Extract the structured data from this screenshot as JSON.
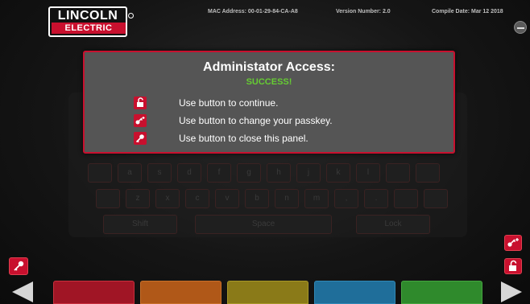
{
  "header": {
    "logo_top": "LINCOLN",
    "logo_bottom": "ELECTRIC",
    "mac_address": "MAC Address: 00-01-29-84-CA-A8",
    "version": "Version Number: 2.0",
    "compile_date": "Compile Date: Mar 12 2018"
  },
  "dialog": {
    "title": "Administator Access:",
    "status": "SUCCESS!",
    "rows": [
      {
        "icon": "unlock-icon",
        "text": "Use button to continue."
      },
      {
        "icon": "key-edit-icon",
        "text": "Use button to change your passkey."
      },
      {
        "icon": "key-icon",
        "text": "Use button to close this panel."
      }
    ]
  },
  "keyboard": {
    "row1": [
      "",
      "a",
      "s",
      "d",
      "f",
      "g",
      "h",
      "j",
      "k",
      "l",
      "",
      ""
    ],
    "row2": [
      "",
      "z",
      "x",
      "c",
      "v",
      "b",
      "n",
      "m",
      ",",
      ".",
      "",
      ""
    ],
    "shift": "Shift",
    "space": "Space",
    "lock": "Lock"
  },
  "colors": {
    "accent": "#c8102e",
    "success": "#66cc33"
  }
}
